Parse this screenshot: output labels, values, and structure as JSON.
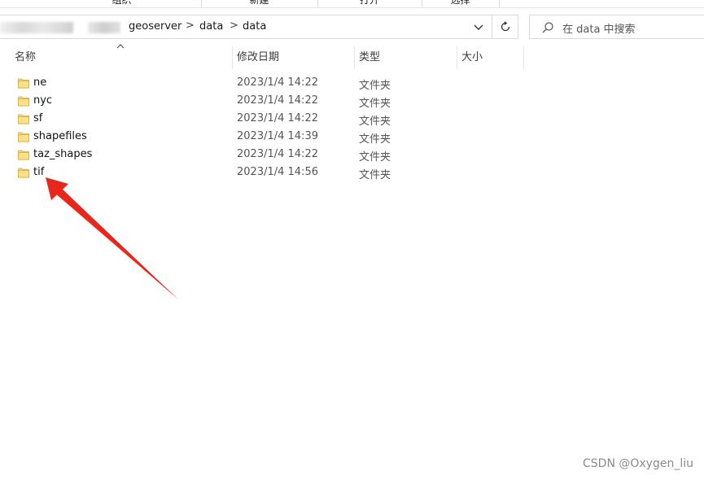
{
  "ribbon": {
    "groups": [
      "组织",
      "新建",
      "打开",
      "选择"
    ]
  },
  "address": {
    "crumbs": [
      "geoserver",
      "data",
      "data"
    ],
    "separator": ">",
    "dropdown_icon": "chevron-down-icon",
    "refresh_icon": "refresh-icon"
  },
  "search": {
    "placeholder": "在 data 中搜索",
    "icon": "search-icon"
  },
  "columns": {
    "name": "名称",
    "date": "修改日期",
    "type": "类型",
    "size": "大小"
  },
  "files": [
    {
      "name": "ne",
      "date": "2023/1/4 14:22",
      "type": "文件夹"
    },
    {
      "name": "nyc",
      "date": "2023/1/4 14:22",
      "type": "文件夹"
    },
    {
      "name": "sf",
      "date": "2023/1/4 14:22",
      "type": "文件夹"
    },
    {
      "name": "shapefiles",
      "date": "2023/1/4 14:39",
      "type": "文件夹"
    },
    {
      "name": "taz_shapes",
      "date": "2023/1/4 14:22",
      "type": "文件夹"
    },
    {
      "name": "tif",
      "date": "2023/1/4 14:56",
      "type": "文件夹"
    }
  ],
  "colors": {
    "folder": "#f8d775",
    "arrow": "#e8261c"
  },
  "watermark": "CSDN @Oxygen_liu"
}
